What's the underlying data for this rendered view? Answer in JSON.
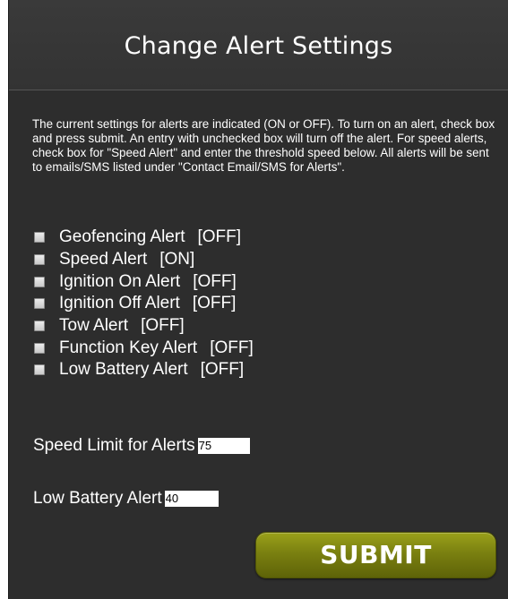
{
  "header": {
    "title": "Change Alert Settings"
  },
  "intro_text": "The current settings for alerts are indicated (ON or OFF). To turn on an alert, check box and press submit. An entry with unchecked box will turn off the alert. For speed alerts, check box for \"Speed Alert\" and enter the threshold speed below. All alerts will be sent to emails/SMS listed under \"Contact Email/SMS for Alerts\".",
  "alerts": [
    {
      "label": "Geofencing Alert",
      "state": "[OFF]"
    },
    {
      "label": "Speed Alert",
      "state": "[ON]"
    },
    {
      "label": "Ignition On Alert",
      "state": "[OFF]"
    },
    {
      "label": "Ignition Off Alert",
      "state": "[OFF]"
    },
    {
      "label": "Tow Alert",
      "state": "[OFF]"
    },
    {
      "label": "Function Key Alert",
      "state": "[OFF]"
    },
    {
      "label": "Low Battery Alert",
      "state": "[OFF]"
    }
  ],
  "speed_limit": {
    "label": "Speed Limit for Alerts",
    "value": "75"
  },
  "low_battery": {
    "label": "Low Battery Alert",
    "value": "40"
  },
  "submit_label": "SUBMIT",
  "colors": {
    "panel_bg": "#2d2d2d",
    "submit_top": "#9aa11a",
    "submit_bottom": "#5e6308",
    "text": "#ffffff"
  }
}
